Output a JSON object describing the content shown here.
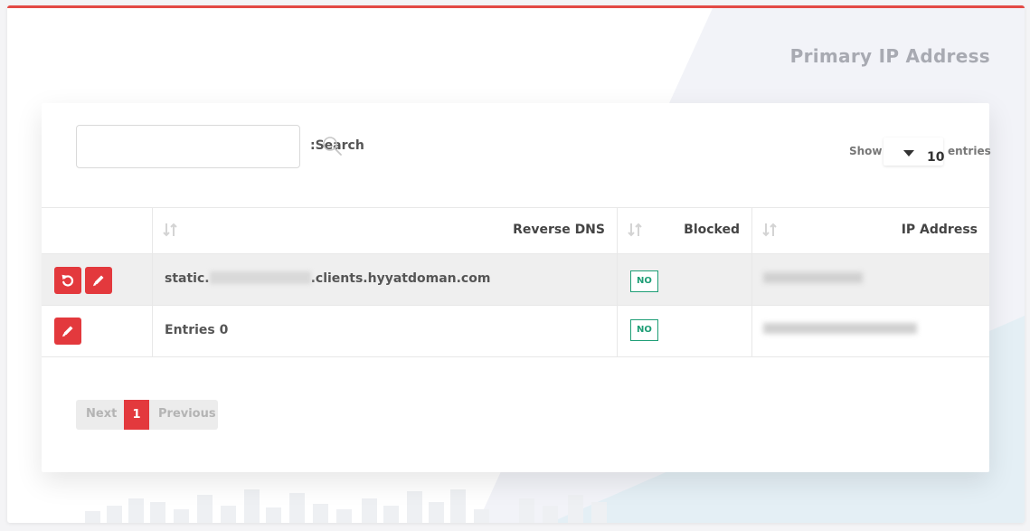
{
  "panel": {
    "title": "Primary IP Address"
  },
  "search": {
    "label": ":Search",
    "value": "",
    "placeholder": ""
  },
  "length": {
    "show": "Show",
    "value": "10",
    "suffix": "entries"
  },
  "table": {
    "columns": [
      "Reverse DNS",
      "Blocked",
      "IP Address"
    ],
    "rows": [
      {
        "dns_prefix": "static.",
        "dns_suffix": ".clients.hyyatdoman.com",
        "blocked": "NO"
      },
      {
        "dns_prefix": "Entries 0",
        "dns_suffix": "",
        "blocked": "NO"
      }
    ]
  },
  "pagination": {
    "next": "Next",
    "page": "1",
    "previous": "Previous"
  },
  "colors": {
    "accent": "#e3393d",
    "success": "#1e9e76"
  }
}
